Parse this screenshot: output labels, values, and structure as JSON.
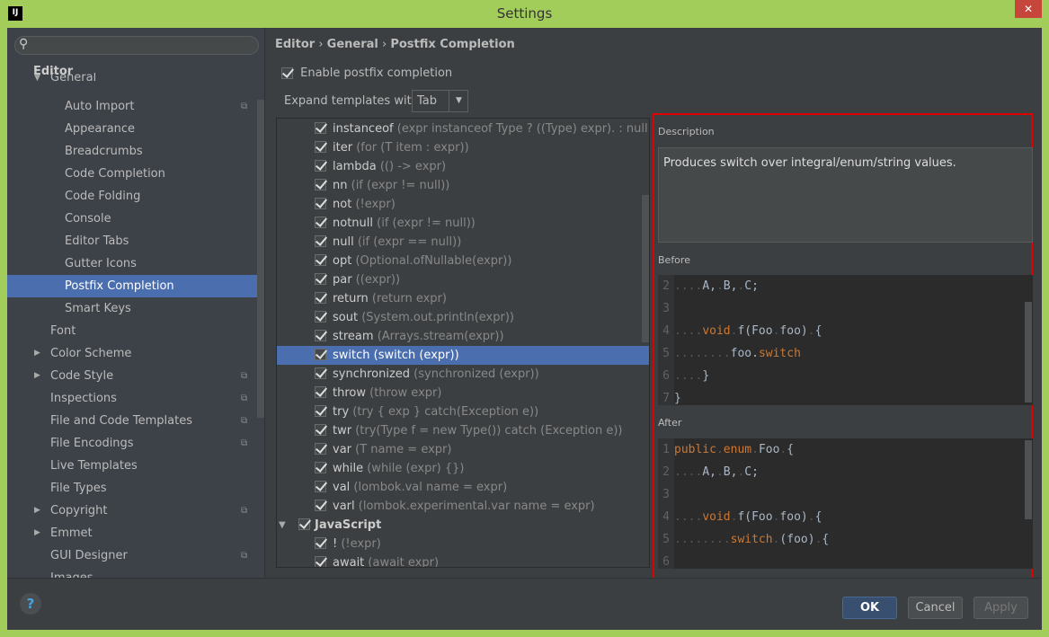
{
  "window": {
    "title": "Settings",
    "app_icon": "IJ",
    "close_icon": "close-icon"
  },
  "sidebar": {
    "search_placeholder": "",
    "editor_label": "Editor",
    "items": [
      {
        "label": "General",
        "level": 1,
        "arrow": "expanded"
      },
      {
        "label": "Auto Import",
        "level": 2,
        "copy": true
      },
      {
        "label": "Appearance",
        "level": 2
      },
      {
        "label": "Breadcrumbs",
        "level": 2
      },
      {
        "label": "Code Completion",
        "level": 2
      },
      {
        "label": "Code Folding",
        "level": 2
      },
      {
        "label": "Console",
        "level": 2
      },
      {
        "label": "Editor Tabs",
        "level": 2
      },
      {
        "label": "Gutter Icons",
        "level": 2
      },
      {
        "label": "Postfix Completion",
        "level": 2,
        "selected": true
      },
      {
        "label": "Smart Keys",
        "level": 2
      },
      {
        "label": "Font",
        "level": 1
      },
      {
        "label": "Color Scheme",
        "level": 1,
        "arrow": "collapsed"
      },
      {
        "label": "Code Style",
        "level": 1,
        "arrow": "collapsed",
        "copy": true
      },
      {
        "label": "Inspections",
        "level": 1,
        "copy": true
      },
      {
        "label": "File and Code Templates",
        "level": 1,
        "copy": true
      },
      {
        "label": "File Encodings",
        "level": 1,
        "copy": true
      },
      {
        "label": "Live Templates",
        "level": 1
      },
      {
        "label": "File Types",
        "level": 1
      },
      {
        "label": "Copyright",
        "level": 1,
        "arrow": "collapsed",
        "copy": true
      },
      {
        "label": "Emmet",
        "level": 1,
        "arrow": "collapsed"
      },
      {
        "label": "GUI Designer",
        "level": 1,
        "copy": true
      },
      {
        "label": "Images",
        "level": 1
      }
    ]
  },
  "breadcrumb": [
    "Editor",
    "General",
    "Postfix Completion"
  ],
  "enable_label": "Enable postfix completion",
  "expand": {
    "label": "Expand templates with",
    "value": "Tab"
  },
  "templates": [
    {
      "name": "instanceof",
      "desc": "(expr instanceof Type ? ((Type) expr). : null)"
    },
    {
      "name": "iter",
      "desc": "(for (T item : expr))"
    },
    {
      "name": "lambda",
      "desc": "(() -> expr)"
    },
    {
      "name": "nn",
      "desc": "(if (expr != null))"
    },
    {
      "name": "not",
      "desc": "(!expr)"
    },
    {
      "name": "notnull",
      "desc": "(if (expr != null))"
    },
    {
      "name": "null",
      "desc": "(if (expr == null))"
    },
    {
      "name": "opt",
      "desc": "(Optional.ofNullable(expr))"
    },
    {
      "name": "par",
      "desc": "((expr))"
    },
    {
      "name": "return",
      "desc": "(return expr)"
    },
    {
      "name": "sout",
      "desc": "(System.out.println(expr))"
    },
    {
      "name": "stream",
      "desc": "(Arrays.stream(expr))"
    },
    {
      "name": "switch",
      "desc": "(switch (expr))",
      "selected": true
    },
    {
      "name": "synchronized",
      "desc": "(synchronized (expr))"
    },
    {
      "name": "throw",
      "desc": "(throw expr)"
    },
    {
      "name": "try",
      "desc": "(try { exp } catch(Exception e))"
    },
    {
      "name": "twr",
      "desc": "(try(Type f = new Type()) catch (Exception e))"
    },
    {
      "name": "var",
      "desc": "(T name = expr)"
    },
    {
      "name": "while",
      "desc": "(while (expr) {})"
    },
    {
      "name": "val",
      "desc": "(lombok.val name = expr)"
    },
    {
      "name": "varl",
      "desc": "(lombok.experimental.var name = expr)"
    },
    {
      "name": "JavaScript",
      "group": true
    },
    {
      "name": "!",
      "desc": "(!expr)"
    },
    {
      "name": "await",
      "desc": "(await expr)"
    }
  ],
  "panel": {
    "description_label": "Description",
    "description": "Produces switch over integral/enum/string values.",
    "before_label": "Before",
    "after_label": "After",
    "before": [
      {
        "n": "2",
        "t": [
          [
            "ws",
            "...."
          ],
          [
            "id",
            "A,"
          ],
          [
            "ws",
            "."
          ],
          [
            "id",
            "B,"
          ],
          [
            "ws",
            "."
          ],
          [
            "id",
            "C;"
          ]
        ]
      },
      {
        "n": "3",
        "t": []
      },
      {
        "n": "4",
        "t": [
          [
            "ws",
            "...."
          ],
          [
            "kw",
            "void"
          ],
          [
            "ws",
            "."
          ],
          [
            "id",
            "f(Foo"
          ],
          [
            "ws",
            "."
          ],
          [
            "id",
            "foo)"
          ],
          [
            "ws",
            "."
          ],
          [
            "id",
            "{"
          ]
        ]
      },
      {
        "n": "5",
        "t": [
          [
            "ws",
            "........"
          ],
          [
            "id",
            "foo."
          ],
          [
            "kw",
            "switch"
          ]
        ]
      },
      {
        "n": "6",
        "t": [
          [
            "ws",
            "...."
          ],
          [
            "id",
            "}"
          ]
        ]
      },
      {
        "n": "7",
        "t": [
          [
            "id",
            "}"
          ]
        ]
      }
    ],
    "after": [
      {
        "n": "1",
        "t": [
          [
            "kw",
            "public"
          ],
          [
            "ws",
            "."
          ],
          [
            "kw",
            "enum"
          ],
          [
            "ws",
            "."
          ],
          [
            "id",
            "Foo"
          ],
          [
            "ws",
            "."
          ],
          [
            "id",
            "{"
          ]
        ]
      },
      {
        "n": "2",
        "t": [
          [
            "ws",
            "...."
          ],
          [
            "id",
            "A,"
          ],
          [
            "ws",
            "."
          ],
          [
            "id",
            "B,"
          ],
          [
            "ws",
            "."
          ],
          [
            "id",
            "C;"
          ]
        ]
      },
      {
        "n": "3",
        "t": []
      },
      {
        "n": "4",
        "t": [
          [
            "ws",
            "...."
          ],
          [
            "kw",
            "void"
          ],
          [
            "ws",
            "."
          ],
          [
            "id",
            "f(Foo"
          ],
          [
            "ws",
            "."
          ],
          [
            "id",
            "foo)"
          ],
          [
            "ws",
            "."
          ],
          [
            "id",
            "{"
          ]
        ]
      },
      {
        "n": "5",
        "t": [
          [
            "ws",
            "........"
          ],
          [
            "kw",
            "switch"
          ],
          [
            "ws",
            "."
          ],
          [
            "id",
            "(foo)"
          ],
          [
            "ws",
            "."
          ],
          [
            "id",
            "{"
          ]
        ]
      },
      {
        "n": "6",
        "t": []
      }
    ]
  },
  "footer": {
    "help": "?",
    "ok": "OK",
    "cancel": "Cancel",
    "apply": "Apply"
  },
  "colors": {
    "selection": "#4b6eaf",
    "keyword": "#cc7832",
    "window_border": "#a3cd5b",
    "highlight_box": "#e00000"
  }
}
